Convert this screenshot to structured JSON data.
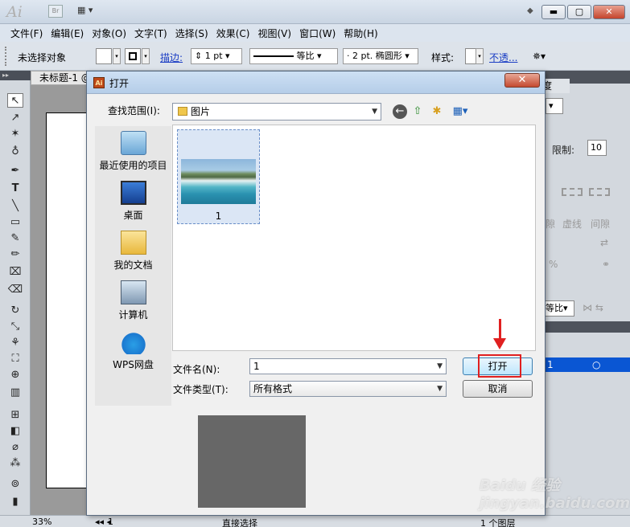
{
  "app": {
    "logo": "Ai",
    "bridge": "Br",
    "window_controls": {
      "minimize": "▬",
      "restore": "▢",
      "close": "✕"
    }
  },
  "menu": [
    "文件(F)",
    "编辑(E)",
    "对象(O)",
    "文字(T)",
    "选择(S)",
    "效果(C)",
    "视图(V)",
    "窗口(W)",
    "帮助(H)"
  ],
  "control_bar": {
    "selection_status": "未选择对象",
    "stroke_label": "描边:",
    "stroke_weight": "1 pt",
    "stroke_profile": "等比",
    "brush": "2 pt. 椭圆形",
    "style_label": "样式:",
    "opacity_link": "不透..."
  },
  "document": {
    "tab_title": "未标题-1 @",
    "zoom": "33%",
    "page": "1",
    "status_tool": "直接选择",
    "layers_status": "1 个图层"
  },
  "right_panel": {
    "tab": "度",
    "limit_label": "限制:",
    "limit_value": "10",
    "labels_row": [
      "隙",
      "虚线",
      "间隙"
    ],
    "aspect": "等比",
    "selected_layer": "1",
    "percent": "%"
  },
  "dialog": {
    "title": "打开",
    "look_in_label": "查找范围(I):",
    "look_in_value": "图片",
    "places": [
      {
        "label": "最近使用的项目",
        "icon": "recent-items-icon"
      },
      {
        "label": "桌面",
        "icon": "desktop-icon"
      },
      {
        "label": "我的文档",
        "icon": "documents-icon"
      },
      {
        "label": "计算机",
        "icon": "computer-icon"
      },
      {
        "label": "WPS网盘",
        "icon": "wps-cloud-icon"
      }
    ],
    "files": [
      {
        "name": "1"
      }
    ],
    "file_name_label": "文件名(N):",
    "file_name_value": "1",
    "file_type_label": "文件类型(T):",
    "file_type_value": "所有格式",
    "open_button": "打开",
    "cancel_button": "取消"
  },
  "colors": {
    "accent_red": "#e02020",
    "selected_blue": "#0a56d3",
    "preview_grey": "#676767"
  },
  "watermark": "Baidu 经验  jingyan.baidu.com"
}
